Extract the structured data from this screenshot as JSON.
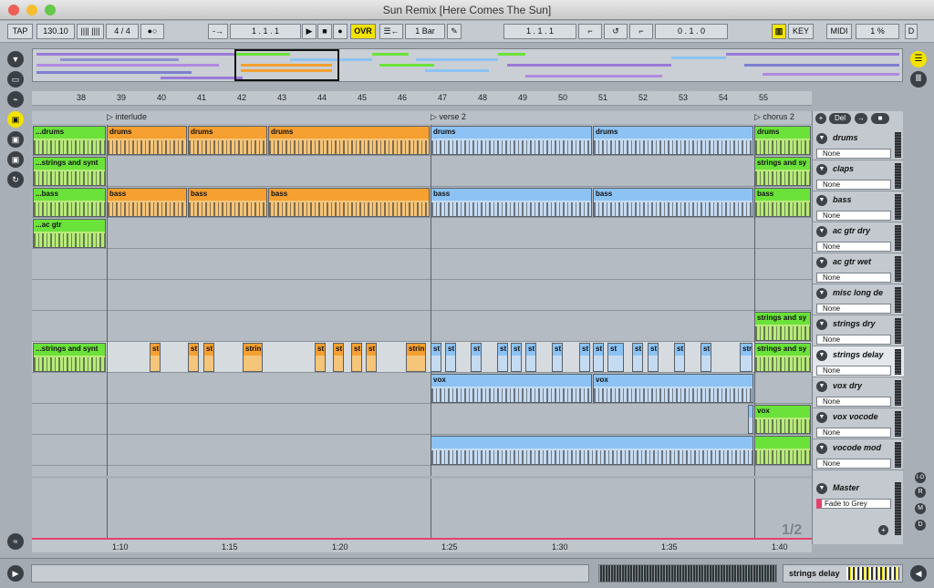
{
  "window": {
    "title": "Sun Remix  [Here Comes The Sun]"
  },
  "control": {
    "tap": "TAP",
    "tempo": "130.10",
    "meter_icon": "|||| ||||",
    "signature": "4 / 4",
    "metronome": "●○",
    "follow": "-→",
    "position": "1 .  1 .  1",
    "play": "▶",
    "stop": "■",
    "record": "●",
    "ovr": "OVR",
    "quantize_icon": "☰←",
    "quantize": "1 Bar",
    "draw": "✎",
    "loop_start": "1 .  1 .  1",
    "punch_in": "⌐",
    "loop_switch": "↺",
    "punch_out": "⌐",
    "loop_length": "0 .  1 .  0",
    "key_icon": "▥",
    "key": "KEY",
    "midi": "MIDI",
    "cpu": "1 %",
    "disk": "D"
  },
  "ruler": {
    "bars": [
      "38",
      "39",
      "40",
      "41",
      "42",
      "43",
      "44",
      "45",
      "46",
      "47",
      "48",
      "49",
      "50",
      "51",
      "52",
      "53",
      "54",
      "55"
    ]
  },
  "locators": [
    {
      "label": "interlude"
    },
    {
      "label": "verse 2"
    },
    {
      "label": "chorus 2"
    }
  ],
  "tracks": [
    {
      "name": "drums",
      "route": "None",
      "clips": [
        "...drums",
        "drums",
        "drums",
        "drums",
        "drums",
        "drums",
        "drums"
      ]
    },
    {
      "name": "claps",
      "route": "None",
      "clips": [
        "...strings and synt",
        "strings and sy"
      ]
    },
    {
      "name": "bass",
      "route": "None",
      "clips": [
        "...bass",
        "bass",
        "bass",
        "bass",
        "bass",
        "bass",
        "bass"
      ]
    },
    {
      "name": "ac gtr dry",
      "route": "None",
      "clips": [
        "...ac gtr"
      ]
    },
    {
      "name": "ac gtr wet",
      "route": "None",
      "clips": []
    },
    {
      "name": "misc long de",
      "route": "None",
      "clips": []
    },
    {
      "name": "strings dry",
      "route": "None",
      "clips": [
        "strings and sy"
      ]
    },
    {
      "name": "strings delay",
      "route": "None",
      "clips": [
        "...strings and synt",
        "st",
        "st",
        "st",
        "strin",
        "st",
        "st",
        "st",
        "st",
        "strin",
        "st",
        "st",
        "st",
        "st",
        "st",
        "st",
        "st",
        "st",
        "st",
        "st",
        "st",
        "st",
        "st",
        "st",
        "str",
        "strings and sy"
      ]
    },
    {
      "name": "vox dry",
      "route": "None",
      "clips": [
        "vox",
        "vox"
      ]
    },
    {
      "name": "vox vocode",
      "route": "None",
      "clips": [
        "vox"
      ]
    },
    {
      "name": "vocode mod",
      "route": "None",
      "clips": [
        "",
        ""
      ]
    }
  ],
  "head_buttons": {
    "add": "+",
    "del": "Del",
    "arrow": "→",
    "lock": "■"
  },
  "master": {
    "name": "Master",
    "route": "Fade to Grey",
    "page": "1/2",
    "add": "+"
  },
  "timeline": [
    "1:10",
    "1:15",
    "1:20",
    "1:25",
    "1:30",
    "1:35",
    "1:40"
  ],
  "right_side": {
    "i": "I·O",
    "r": "R",
    "m": "M",
    "d": "D"
  },
  "status": {
    "track": "strings delay",
    "play_icon": "▶",
    "back_icon": "◀"
  },
  "colors": {
    "green": "#6be23a",
    "orange": "#f5a030",
    "blue": "#8cc3f4",
    "playhead": "#e4416d",
    "accent": "#f2e300"
  }
}
